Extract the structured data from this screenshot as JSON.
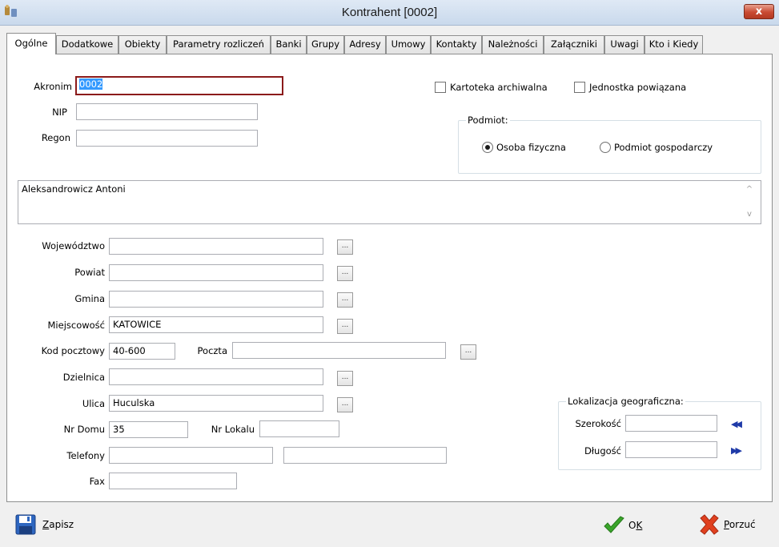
{
  "window": {
    "title": "Kontrahent [0002]"
  },
  "tabs": [
    {
      "label": "Ogólne"
    },
    {
      "label": "Dodatkowe"
    },
    {
      "label": "Obiekty"
    },
    {
      "label": "Parametry rozliczeń"
    },
    {
      "label": "Banki"
    },
    {
      "label": "Grupy"
    },
    {
      "label": "Adresy"
    },
    {
      "label": "Umowy"
    },
    {
      "label": "Kontakty"
    },
    {
      "label": "Należności"
    },
    {
      "label": "Załączniki"
    },
    {
      "label": "Uwagi"
    },
    {
      "label": "Kto i Kiedy"
    }
  ],
  "form": {
    "akronim_label": "Akronim",
    "akronim_value": "0002",
    "nip_label": "NIP",
    "nip_value": "",
    "regon_label": "Regon",
    "regon_value": "",
    "kartoteka_label": "Kartoteka archiwalna",
    "jednostka_label": "Jednostka powiązana",
    "podmiot_title": "Podmiot:",
    "osoba_label": "Osoba fizyczna",
    "gospodarczy_label": "Podmiot gospodarczy",
    "name_value": "Aleksandrowicz Antoni",
    "wojewodztwo_label": "Województwo",
    "wojewodztwo_value": "",
    "powiat_label": "Powiat",
    "powiat_value": "",
    "gmina_label": "Gmina",
    "gmina_value": "",
    "miejscowosc_label": "Miejscowość",
    "miejscowosc_value": "KATOWICE",
    "kod_label": "Kod pocztowy",
    "kod_value": "40-600",
    "poczta_label": "Poczta",
    "poczta_value": "",
    "dzielnica_label": "Dzielnica",
    "dzielnica_value": "",
    "ulica_label": "Ulica",
    "ulica_value": "Huculska",
    "nrdomu_label": "Nr Domu",
    "nrdomu_value": "35",
    "nrlokalu_label": "Nr Lokalu",
    "nrlokalu_value": "",
    "telefony_label": "Telefony",
    "telefony1_value": "",
    "telefony2_value": "",
    "fax_label": "Fax",
    "fax_value": "",
    "geo_title": "Lokalizacja geograficzna:",
    "szerokosc_label": "Szerokość",
    "szerokosc_value": "",
    "dlugosc_label": "Długość",
    "dlugosc_value": "",
    "dots": "..."
  },
  "footer": {
    "zapisz_first": "Z",
    "zapisz_rest": "apisz",
    "ok_first": "O",
    "ok_rest": "K",
    "porzuc_first": "P",
    "porzuc_rest": "orzuć"
  },
  "icons": {
    "close": "x",
    "scroll_up": "^",
    "scroll_down": "v",
    "rewind": "◀◀",
    "forward": "▶▶"
  },
  "colors": {
    "focus_border": "#8b1a1a",
    "selection": "#3399ff",
    "ok_green": "#3aa52b",
    "cancel_red": "#e0401f"
  }
}
